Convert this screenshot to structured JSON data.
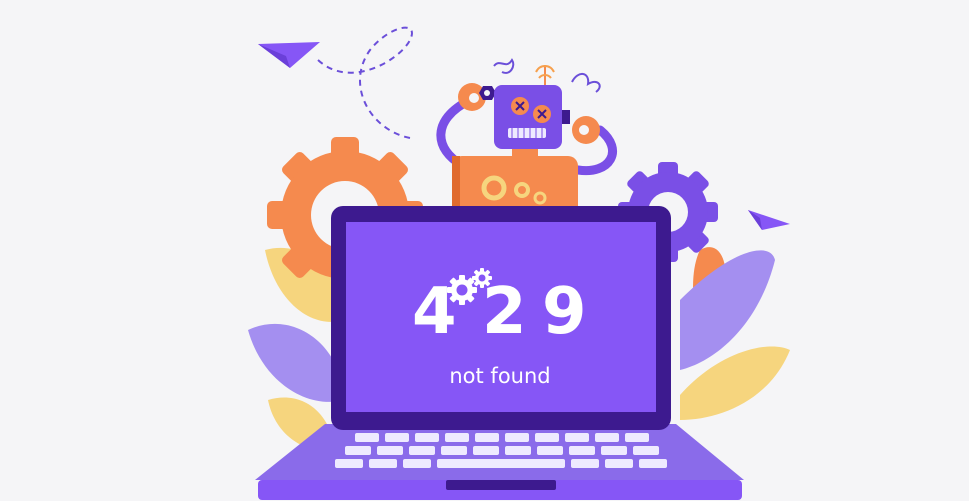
{
  "error": {
    "code_digits": [
      "4",
      "2",
      "9"
    ],
    "message": "not found"
  },
  "colors": {
    "background": "#f5f5f7",
    "laptop_frame": "#3d1a8f",
    "laptop_screen": "#8656f6",
    "keyboard_base": "#8a6bea",
    "keys": "#eeeaff",
    "gear_orange": "#f58a4e",
    "gear_purple": "#7a4fe6",
    "leaf_yellow": "#f6d57e",
    "leaf_purple": "#a48ff0",
    "robot_head": "#7a4fe6",
    "robot_body": "#f58a4e",
    "paper_plane": "#8656f6"
  },
  "icons": [
    "paper-plane-icon",
    "gear-icon",
    "robot-illustration",
    "laptop-illustration",
    "leaf-icon"
  ]
}
